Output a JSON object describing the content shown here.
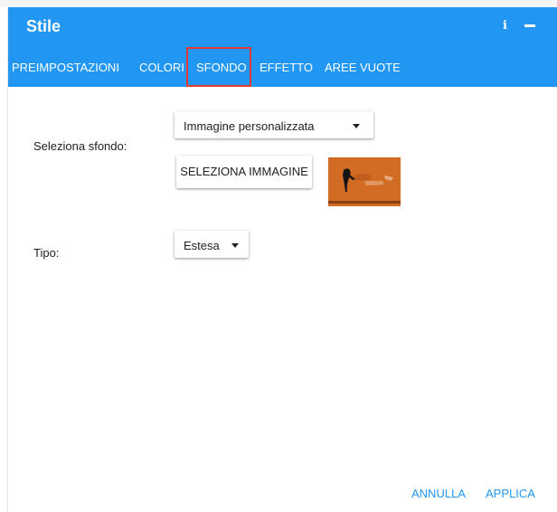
{
  "dialog": {
    "title": "Stile"
  },
  "header": {
    "info_icon": "i",
    "info_icon_name": "info-icon",
    "minimize_icon_name": "minimize-icon",
    "color": "#2196f3"
  },
  "tabs": [
    {
      "label": "Preimpostazioni",
      "selected": false
    },
    {
      "label": "Colori",
      "selected": false
    },
    {
      "label": "Sfondo",
      "selected": true
    },
    {
      "label": "Effetto",
      "selected": false
    },
    {
      "label": "Aree vuote",
      "selected": false
    }
  ],
  "highlight_color": "#e53935",
  "background": {
    "label": "Seleziona sfondo:",
    "selected_value": "Immagine personalizzata",
    "select_image_button": "Seleziona immagine",
    "thumbnail_icon": "image-thumbnail"
  },
  "type": {
    "label": "Tipo:",
    "selected_value": "Estesa"
  },
  "actions": {
    "cancel": "Annulla",
    "apply": "Applica"
  },
  "accent_color": "#2196f3"
}
